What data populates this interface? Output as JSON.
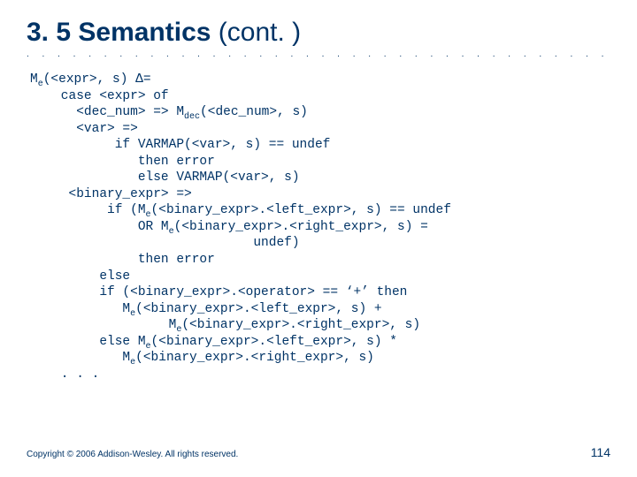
{
  "title_main": "3. 5 Semantics ",
  "title_cont": "(cont. )",
  "dots": ". . . . . . . . . . . . . . . . . . . . . . . . . . . . . . . . . . . . . . . . . . . . . . . . . . . . . . . . . . . . . .",
  "code_lines": [
    "M<sub>e</sub>(&lt;expr&gt;, s) &#916;=",
    "    case &lt;expr&gt; of",
    "      &lt;dec_num&gt; =&gt; M<sub>dec</sub>(&lt;dec_num&gt;, s)",
    "      &lt;var&gt; =&gt;",
    "           if VARMAP(&lt;var&gt;, s) == undef",
    "              then error",
    "              else VARMAP(&lt;var&gt;, s)",
    "     &lt;binary_expr&gt; =&gt;",
    "          if (M<sub>e</sub>(&lt;binary_expr&gt;.&lt;left_expr&gt;, s) == undef",
    "              OR M<sub>e</sub>(&lt;binary_expr&gt;.&lt;right_expr&gt;, s) =",
    "                             undef)",
    "              then error",
    "         else",
    "         if (&lt;binary_expr&gt;.&lt;operator&gt; == &#8216;+&#8217; then",
    "            M<sub>e</sub>(&lt;binary_expr&gt;.&lt;left_expr&gt;, s) +",
    "                  M<sub>e</sub>(&lt;binary_expr&gt;.&lt;right_expr&gt;, s)",
    "         else M<sub>e</sub>(&lt;binary_expr&gt;.&lt;left_expr&gt;, s) *",
    "            M<sub>e</sub>(&lt;binary_expr&gt;.&lt;right_expr&gt;, s)",
    "    . . ."
  ],
  "copyright": "Copyright © 2006 Addison-Wesley. All rights reserved.",
  "pagenum": "114"
}
